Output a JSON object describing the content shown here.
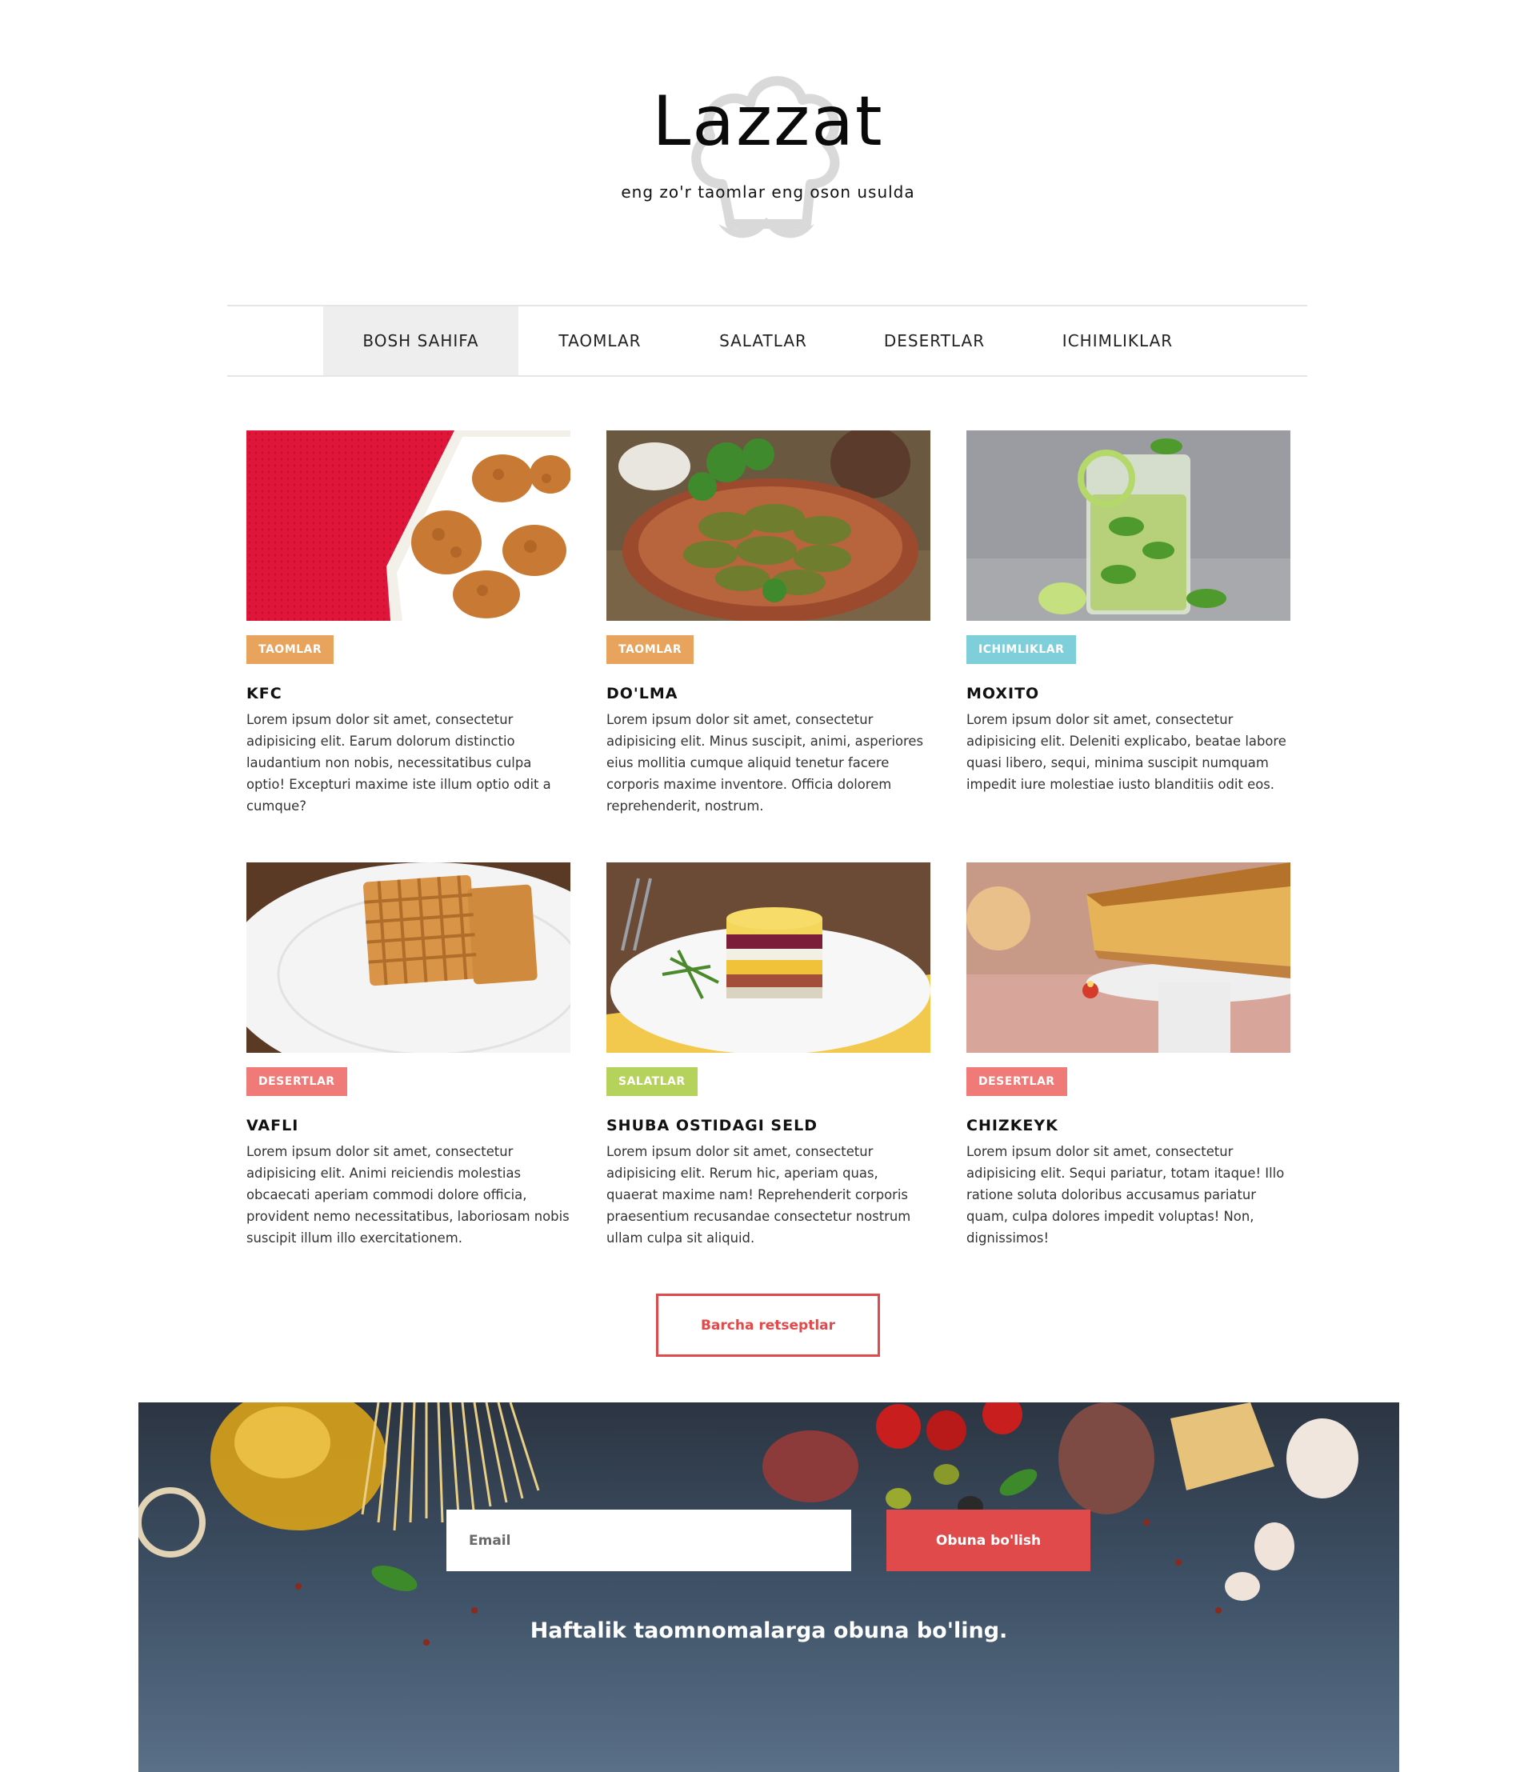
{
  "brand": {
    "title": "Lazzat",
    "tagline": "eng zo'r taomlar eng oson usulda"
  },
  "nav": {
    "items": [
      {
        "label": "BOSH SAHIFA",
        "active": true
      },
      {
        "label": "TAOMLAR",
        "active": false
      },
      {
        "label": "SALATLAR",
        "active": false
      },
      {
        "label": "DESERTLAR",
        "active": false
      },
      {
        "label": "ICHIMLIKLAR",
        "active": false
      }
    ]
  },
  "cards": [
    {
      "category": "TAOMLAR",
      "category_color": "#e8a45c",
      "title": "KFC",
      "image": "fried-chicken-image",
      "text": "Lorem ipsum dolor sit amet, consectetur adipisicing elit. Earum dolorum distinctio laudantium non nobis, necessitatibus culpa optio! Excepturi maxime iste illum optio odit a cumque?"
    },
    {
      "category": "TAOMLAR",
      "category_color": "#e8a45c",
      "title": "DO'LMA",
      "image": "dolma-image",
      "text": "Lorem ipsum dolor sit amet, consectetur adipisicing elit. Minus suscipit, animi, asperiores eius mollitia cumque aliquid tenetur facere corporis maxime inventore. Officia dolorem reprehenderit, nostrum."
    },
    {
      "category": "ICHIMLIKLAR",
      "category_color": "#7fcfdb",
      "title": "MOXITO",
      "image": "mojito-image",
      "text": "Lorem ipsum dolor sit amet, consectetur adipisicing elit. Deleniti explicabo, beatae labore quasi libero, sequi, minima suscipit numquam impedit iure molestiae iusto blanditiis odit eos."
    },
    {
      "category": "DESERTLAR",
      "category_color": "#f07a78",
      "title": "VAFLI",
      "image": "waffle-image",
      "text": "Lorem ipsum dolor sit amet, consectetur adipisicing elit. Animi reiciendis molestias obcaecati aperiam commodi dolore officia, provident nemo necessitatibus, laboriosam nobis suscipit illum illo exercitationem."
    },
    {
      "category": "SALATLAR",
      "category_color": "#b5d25a",
      "title": "SHUBA OSTIDAGI SELD",
      "image": "layered-salad-image",
      "text": "Lorem ipsum dolor sit amet, consectetur adipisicing elit. Rerum hic, aperiam quas, quaerat maxime nam! Reprehenderit corporis praesentium recusandae consectetur nostrum ullam culpa sit aliquid."
    },
    {
      "category": "DESERTLAR",
      "category_color": "#f07a78",
      "title": "CHIZKEYK",
      "image": "cheesecake-image",
      "text": "Lorem ipsum dolor sit amet, consectetur adipisicing elit. Sequi pariatur, totam itaque! Illo ratione soluta doloribus accusamus pariatur quam, culpa dolores impedit voluptas! Non, dignissimos!"
    }
  ],
  "all_recipes_button": "Barcha retseptlar",
  "newsletter": {
    "email_placeholder": "Email",
    "email_value": "",
    "subscribe_label": "Obuna bo'lish",
    "text": "Haftalik taomnomalarga obuna bo'ling."
  },
  "colors": {
    "accent": "#e04a4a",
    "nav_active_bg": "#eeeeee",
    "newsletter_bg": "#3a4a5c"
  }
}
